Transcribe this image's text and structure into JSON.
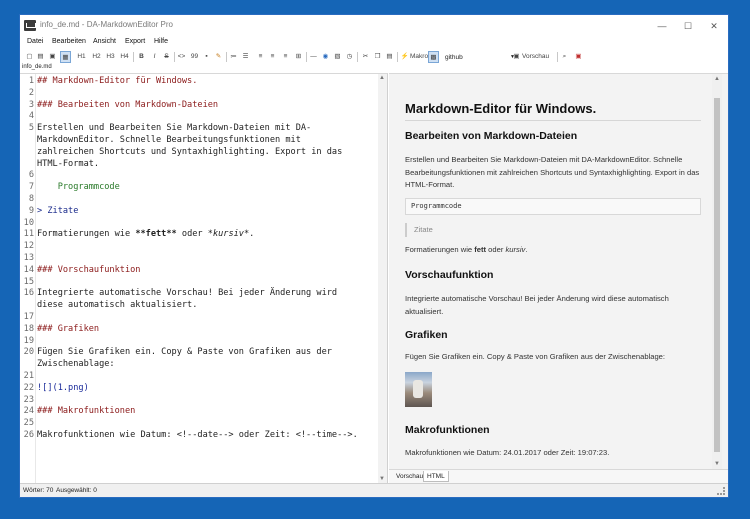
{
  "window": {
    "title": "info_de.md - DA-MarkdownEditor Pro",
    "minimize": "—",
    "maximize": "☐",
    "close": "✕"
  },
  "menu": [
    "Datei",
    "Bearbeiten",
    "Ansicht",
    "Export",
    "Hilfe"
  ],
  "toolbar": {
    "h1": "H1",
    "h2": "H2",
    "h3": "H3",
    "h4": "H4",
    "bold": "B",
    "italic": "I",
    "strike": "S",
    "code": "<>",
    "quote": "99",
    "macro_label": "Makro",
    "style_value": "github",
    "preview_label": "Vorschau"
  },
  "file_tab": "info_de.md",
  "editor_lines": [
    {
      "n": "1",
      "text": "## Markdown-Editor für Windows.",
      "cls": "c-head"
    },
    {
      "n": "2",
      "text": "",
      "cls": ""
    },
    {
      "n": "3",
      "text": "### Bearbeiten von Markdown-Dateien",
      "cls": "c-head"
    },
    {
      "n": "4",
      "text": "",
      "cls": ""
    },
    {
      "n": "5",
      "text": "Erstellen und Bearbeiten Sie Markdown-Dateien mit DA-",
      "cls": ""
    },
    {
      "n": "",
      "text": "MarkdownEditor. Schnelle Bearbeitungsfunktionen mit",
      "cls": ""
    },
    {
      "n": "",
      "text": "zahlreichen Shortcuts und Syntaxhighlighting. Export in das",
      "cls": ""
    },
    {
      "n": "",
      "text": "HTML-Format.",
      "cls": ""
    },
    {
      "n": "6",
      "text": "",
      "cls": ""
    },
    {
      "n": "7",
      "text": "    Programmcode",
      "cls": "c-code"
    },
    {
      "n": "8",
      "text": "",
      "cls": ""
    },
    {
      "n": "9",
      "text": "> Zitate",
      "cls": "c-quote"
    },
    {
      "n": "10",
      "text": "",
      "cls": ""
    },
    {
      "n": "11",
      "text": "",
      "cls": "",
      "parts": [
        {
          "t": "Formatierungen wie ",
          "c": ""
        },
        {
          "t": "**fett**",
          "c": "c-bold"
        },
        {
          "t": " oder ",
          "c": ""
        },
        {
          "t": "*kursiv*",
          "c": "c-ital"
        },
        {
          "t": ".",
          "c": ""
        }
      ]
    },
    {
      "n": "12",
      "text": "",
      "cls": ""
    },
    {
      "n": "13",
      "text": "",
      "cls": ""
    },
    {
      "n": "14",
      "text": "### Vorschaufunktion",
      "cls": "c-head"
    },
    {
      "n": "15",
      "text": "",
      "cls": ""
    },
    {
      "n": "16",
      "text": "Integrierte automatische Vorschau! Bei jeder Änderung wird",
      "cls": ""
    },
    {
      "n": "",
      "text": "diese automatisch aktualisiert.",
      "cls": ""
    },
    {
      "n": "17",
      "text": "",
      "cls": ""
    },
    {
      "n": "18",
      "text": "### Grafiken",
      "cls": "c-head"
    },
    {
      "n": "19",
      "text": "",
      "cls": ""
    },
    {
      "n": "20",
      "text": "Fügen Sie Grafiken ein. Copy & Paste von Grafiken aus der",
      "cls": ""
    },
    {
      "n": "",
      "text": "Zwischenablage:",
      "cls": ""
    },
    {
      "n": "21",
      "text": "",
      "cls": ""
    },
    {
      "n": "22",
      "text": "![](1.png)",
      "cls": "c-link"
    },
    {
      "n": "23",
      "text": "",
      "cls": ""
    },
    {
      "n": "24",
      "text": "### Makrofunktionen",
      "cls": "c-head"
    },
    {
      "n": "25",
      "text": "",
      "cls": ""
    },
    {
      "n": "26",
      "text": "Makrofunktionen wie Datum: <!--date--> oder Zeit: <!--time-->.",
      "cls": ""
    }
  ],
  "preview": {
    "h1": "Markdown-Editor für Windows.",
    "h3_edit": "Bearbeiten von Markdown-Dateien",
    "p_edit": "Erstellen und Bearbeiten Sie Markdown-Dateien mit DA-MarkdownEditor. Schnelle Bearbeitungsfunktionen mit zahlreichen Shortcuts und Syntaxhighlighting. Export in das HTML-Format.",
    "code": "Programmcode",
    "quote": "Zitate",
    "fmt_pre": "Formatierungen wie ",
    "fmt_bold": "fett",
    "fmt_mid": " oder ",
    "fmt_ital": "kursiv",
    "fmt_post": ".",
    "h3_preview": "Vorschaufunktion",
    "p_preview": "Integrierte automatische Vorschau! Bei jeder Änderung wird diese automatisch aktualisiert.",
    "h3_images": "Grafiken",
    "p_images": "Fügen Sie Grafiken ein. Copy & Paste von Grafiken aus der Zwischenablage:",
    "h3_macro": "Makrofunktionen",
    "p_macro": "Makrofunktionen wie Datum: 24.01.2017 oder Zeit: 19:07:23."
  },
  "preview_tabs": [
    "Vorschau",
    "HTML"
  ],
  "status": {
    "words": "Wörter: 70",
    "selected": "Ausgewählt: 0"
  }
}
